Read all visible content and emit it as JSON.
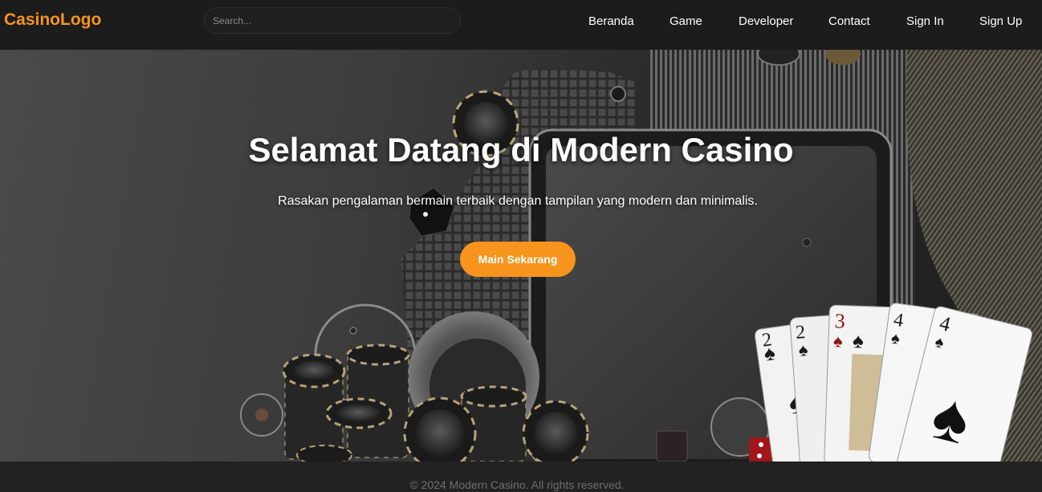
{
  "header": {
    "logo": "CasinoLogo",
    "search_placeholder": "Search...",
    "nav": [
      {
        "label": "Beranda"
      },
      {
        "label": "Game"
      },
      {
        "label": "Developer"
      },
      {
        "label": "Contact"
      },
      {
        "label": "Sign In"
      },
      {
        "label": "Sign Up"
      }
    ]
  },
  "hero": {
    "title": "Selamat Datang di Modern Casino",
    "subtitle": "Rasakan pengalaman bermain terbaik dengan tampilan yang modern dan minimalis.",
    "cta_label": "Main Sekarang",
    "background_image": "casino chips, dice and playing cards on dark backdrop",
    "card_ranks": [
      "2",
      "2",
      "3",
      "4",
      "4"
    ]
  },
  "footer": {
    "copyright": "© 2024 Modern Casino. All rights reserved."
  },
  "colors": {
    "accent": "#f7941d",
    "header_bg": "#1c1c1c",
    "footer_bg": "#222222",
    "footer_text": "#6e6e6e"
  }
}
